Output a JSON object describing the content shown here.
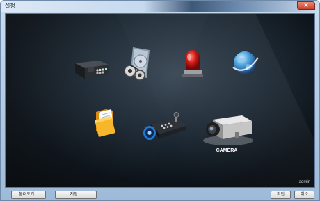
{
  "window": {
    "title": "설정",
    "close_glyph": "×"
  },
  "icons": [
    {
      "name": "dvr-recorder-icon"
    },
    {
      "name": "hard-disk-reels-icon"
    },
    {
      "name": "alarm-siren-icon"
    },
    {
      "name": "network-globe-icon"
    },
    {
      "name": "folder-icon"
    },
    {
      "name": "ptz-controller-icon"
    },
    {
      "name": "camera-icon",
      "label": "CAMERA"
    }
  ],
  "status": {
    "user": "admin"
  },
  "buttons": {
    "load": "불러오기...",
    "save": "저장...",
    "ok": "확인",
    "cancel": "취소"
  }
}
